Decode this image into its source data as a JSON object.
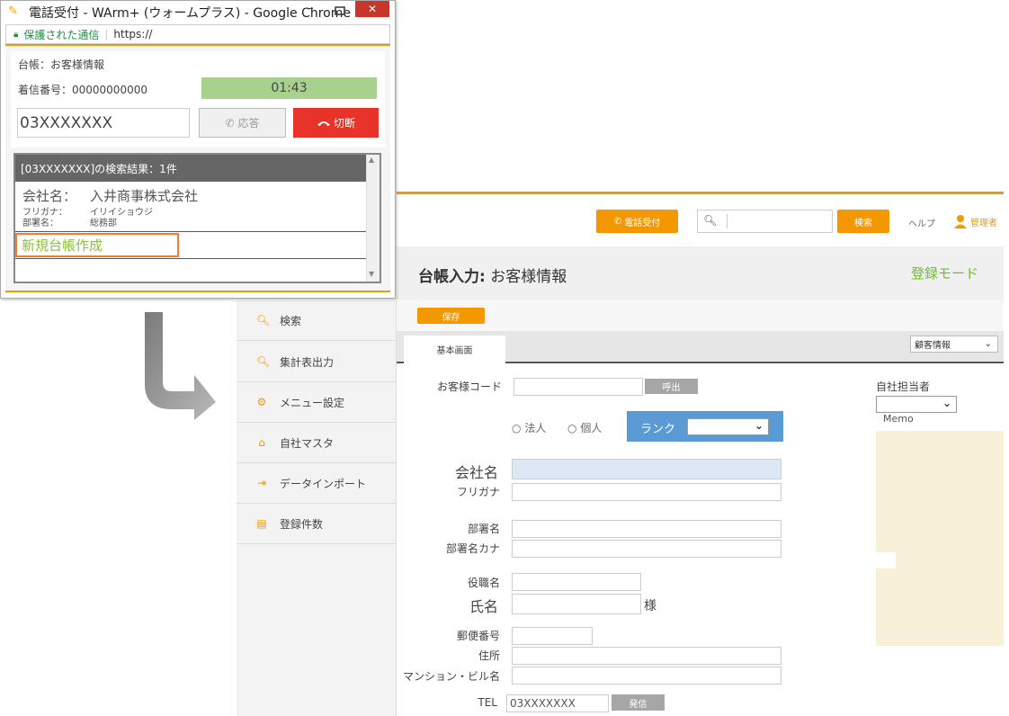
{
  "app": {
    "header": {
      "phone_button": "電話受付",
      "search_placeholder": "",
      "search_button": "検索",
      "help": "ヘルプ",
      "user": "管理者"
    },
    "sidebar": {
      "items": [
        {
          "label": "検索",
          "icon": "search-icon"
        },
        {
          "label": "集計表出力",
          "icon": "search-icon"
        },
        {
          "label": "メニュー設定",
          "icon": "gear-icon"
        },
        {
          "label": "自社マスタ",
          "icon": "home-icon"
        },
        {
          "label": "データインポート",
          "icon": "import-icon"
        },
        {
          "label": "登録件数",
          "icon": "document-icon"
        }
      ]
    },
    "page": {
      "title_bold": "台帳入力:",
      "title_rest": " お客様情報",
      "mode": "登録モード",
      "save_button": "保存",
      "tab_basic": "基本画面",
      "tab_select": "顧客情報"
    },
    "form": {
      "customer_code": "お客様コード",
      "call_button": "呼出",
      "radio_corporate": "法人",
      "radio_individual": "個人",
      "rank": "ランク",
      "company_name": "会社名",
      "furigana": "フリガナ",
      "department": "部署名",
      "department_kana": "部署名カナ",
      "position": "役職名",
      "person_name": "氏名",
      "honorific": "様",
      "postal_code": "郵便番号",
      "address": "住所",
      "building": "マンション・ビル名",
      "tel": "TEL",
      "tel_value": "03XXXXXXX",
      "dial_button": "発信",
      "staff": "自社担当者",
      "memo": "Memo"
    }
  },
  "popup": {
    "window_title": "電話受付 - WArm+ (ウォームプラス) - Google Chrome",
    "secure_label": "保護された通信",
    "url": "https://",
    "book": "台帳：お客様情報",
    "incoming": "着信番号：00000000000",
    "timer": "01:43",
    "number": "03XXXXXXX",
    "answer_button": "応答",
    "hangup_button": "切断",
    "results_header": "[03XXXXXXX]の検索結果：1件",
    "company_label": "会社名：",
    "company_value": "入井商事株式会社",
    "kana_label": "フリガナ：",
    "kana_value": "イリイショウジ",
    "dept_label": "部署名：",
    "dept_value": "総務部",
    "new_book": "新規台帳作成"
  },
  "colors": {
    "accent_orange": "#f39800",
    "mode_green": "#6dbe2e",
    "hangup_red": "#e8332a",
    "timer_green": "#a9d18e",
    "rank_blue": "#5b9bd5",
    "memo_bg": "#f8f0d8"
  }
}
